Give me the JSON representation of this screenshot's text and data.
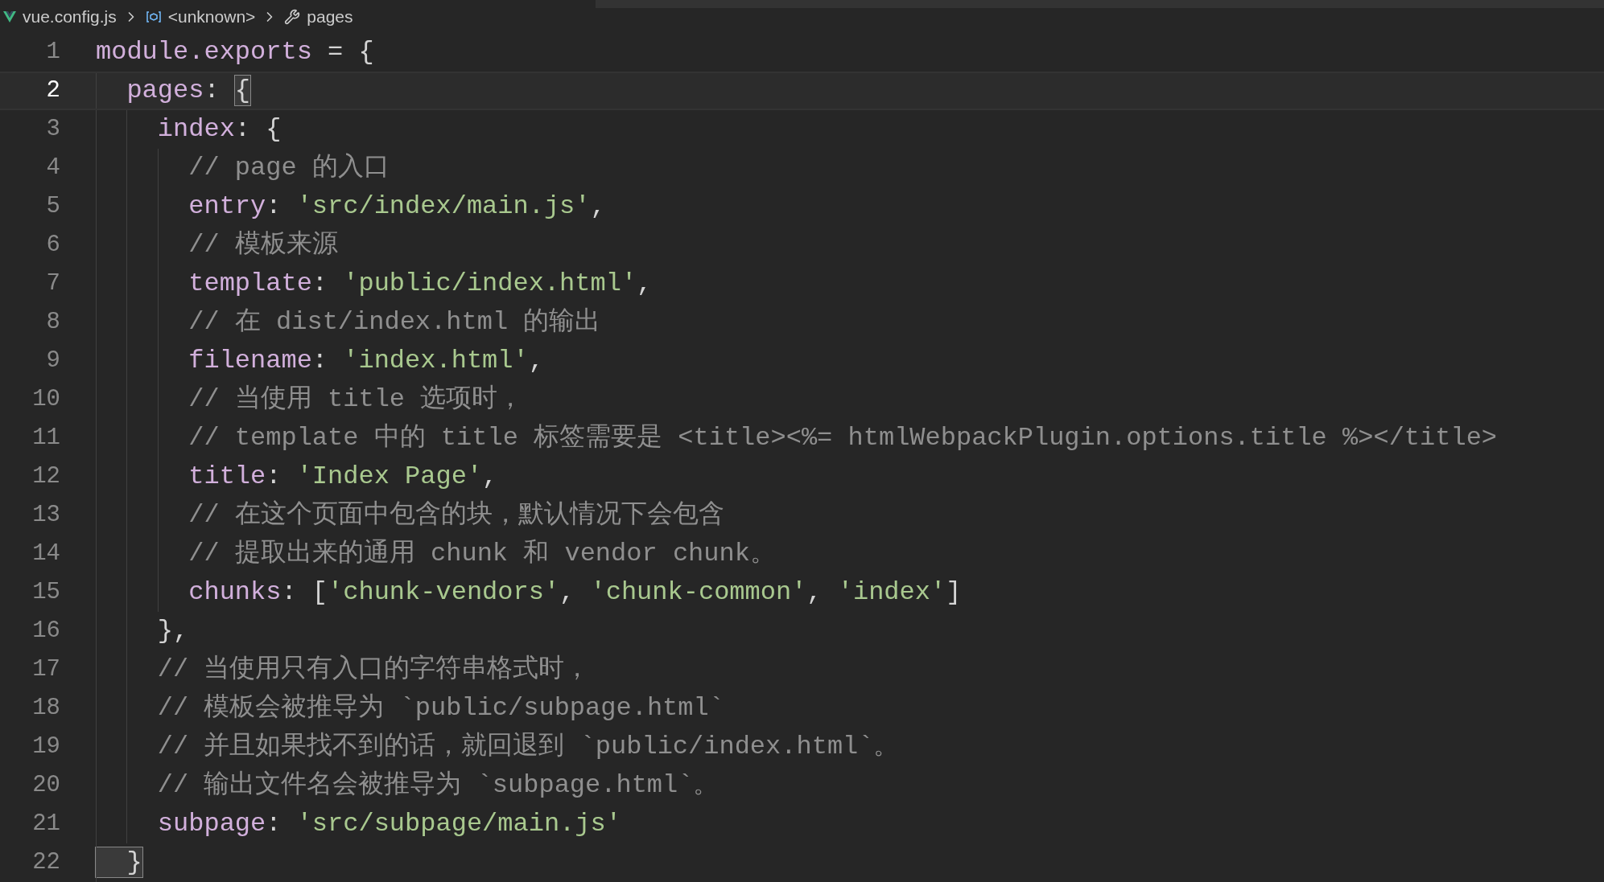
{
  "breadcrumb": [
    {
      "kind": "file",
      "label": "vue.config.js"
    },
    {
      "kind": "symbol",
      "label": "<unknown>"
    },
    {
      "kind": "property",
      "label": "pages"
    }
  ],
  "lines": [
    {
      "number": "1",
      "current": false,
      "tokens": [
        {
          "kind": "prop",
          "text": "module.exports"
        },
        {
          "kind": "punct",
          "text": " = {"
        }
      ]
    },
    {
      "number": "2",
      "current": true,
      "tokens": [
        {
          "kind": "prop",
          "text": "  pages"
        },
        {
          "kind": "punct",
          "text": ": "
        },
        {
          "kind": "bracket",
          "text": "{"
        }
      ]
    },
    {
      "number": "3",
      "current": false,
      "tokens": [
        {
          "kind": "prop",
          "text": "    index"
        },
        {
          "kind": "punct",
          "text": ": {"
        }
      ]
    },
    {
      "number": "4",
      "current": false,
      "tokens": [
        {
          "kind": "comment",
          "text": "      // page 的入口"
        }
      ]
    },
    {
      "number": "5",
      "current": false,
      "tokens": [
        {
          "kind": "prop",
          "text": "      entry"
        },
        {
          "kind": "punct",
          "text": ": "
        },
        {
          "kind": "str",
          "text": "'src/index/main.js'"
        },
        {
          "kind": "punct",
          "text": ","
        }
      ]
    },
    {
      "number": "6",
      "current": false,
      "tokens": [
        {
          "kind": "comment",
          "text": "      // 模板来源"
        }
      ]
    },
    {
      "number": "7",
      "current": false,
      "tokens": [
        {
          "kind": "prop",
          "text": "      template"
        },
        {
          "kind": "punct",
          "text": ": "
        },
        {
          "kind": "str",
          "text": "'public/index.html'"
        },
        {
          "kind": "punct",
          "text": ","
        }
      ]
    },
    {
      "number": "8",
      "current": false,
      "tokens": [
        {
          "kind": "comment",
          "text": "      // 在 dist/index.html 的输出"
        }
      ]
    },
    {
      "number": "9",
      "current": false,
      "tokens": [
        {
          "kind": "prop",
          "text": "      filename"
        },
        {
          "kind": "punct",
          "text": ": "
        },
        {
          "kind": "str",
          "text": "'index.html'"
        },
        {
          "kind": "punct",
          "text": ","
        }
      ]
    },
    {
      "number": "10",
      "current": false,
      "tokens": [
        {
          "kind": "comment",
          "text": "      // 当使用 title 选项时，"
        }
      ]
    },
    {
      "number": "11",
      "current": false,
      "tokens": [
        {
          "kind": "comment",
          "text": "      // template 中的 title 标签需要是 <title><%= htmlWebpackPlugin.options.title %></title>"
        }
      ]
    },
    {
      "number": "12",
      "current": false,
      "tokens": [
        {
          "kind": "prop",
          "text": "      title"
        },
        {
          "kind": "punct",
          "text": ": "
        },
        {
          "kind": "str",
          "text": "'Index Page'"
        },
        {
          "kind": "punct",
          "text": ","
        }
      ]
    },
    {
      "number": "13",
      "current": false,
      "tokens": [
        {
          "kind": "comment",
          "text": "      // 在这个页面中包含的块，默认情况下会包含"
        }
      ]
    },
    {
      "number": "14",
      "current": false,
      "tokens": [
        {
          "kind": "comment",
          "text": "      // 提取出来的通用 chunk 和 vendor chunk。"
        }
      ]
    },
    {
      "number": "15",
      "current": false,
      "tokens": [
        {
          "kind": "prop",
          "text": "      chunks"
        },
        {
          "kind": "punct",
          "text": ": ["
        },
        {
          "kind": "str",
          "text": "'chunk-vendors'"
        },
        {
          "kind": "punct",
          "text": ", "
        },
        {
          "kind": "str",
          "text": "'chunk-common'"
        },
        {
          "kind": "punct",
          "text": ", "
        },
        {
          "kind": "str",
          "text": "'index'"
        },
        {
          "kind": "punct",
          "text": "]"
        }
      ]
    },
    {
      "number": "16",
      "current": false,
      "tokens": [
        {
          "kind": "punct",
          "text": "    },"
        }
      ]
    },
    {
      "number": "17",
      "current": false,
      "tokens": [
        {
          "kind": "comment",
          "text": "    // 当使用只有入口的字符串格式时，"
        }
      ]
    },
    {
      "number": "18",
      "current": false,
      "tokens": [
        {
          "kind": "comment",
          "text": "    // 模板会被推导为 `public/subpage.html`"
        }
      ]
    },
    {
      "number": "19",
      "current": false,
      "tokens": [
        {
          "kind": "comment",
          "text": "    // 并且如果找不到的话，就回退到 `public/index.html`。"
        }
      ]
    },
    {
      "number": "20",
      "current": false,
      "tokens": [
        {
          "kind": "comment",
          "text": "    // 输出文件名会被推导为 `subpage.html`。"
        }
      ]
    },
    {
      "number": "21",
      "current": false,
      "tokens": [
        {
          "kind": "prop",
          "text": "    subpage"
        },
        {
          "kind": "punct",
          "text": ": "
        },
        {
          "kind": "str",
          "text": "'src/subpage/main.js'"
        }
      ]
    },
    {
      "number": "22",
      "current": false,
      "tokens": [
        {
          "kind": "bracket",
          "text": "  }"
        }
      ]
    }
  ]
}
